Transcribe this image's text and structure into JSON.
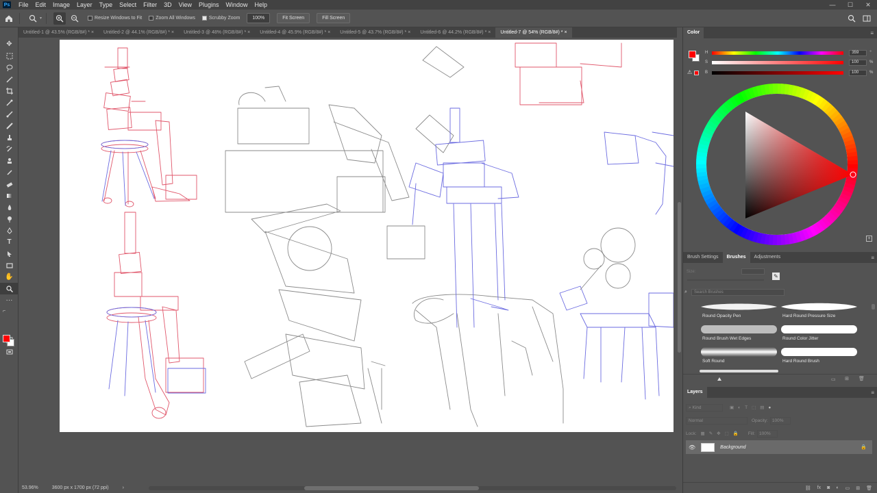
{
  "menubar": {
    "logo": "Ps",
    "items": [
      "File",
      "Edit",
      "Image",
      "Layer",
      "Type",
      "Select",
      "Filter",
      "3D",
      "View",
      "Plugins",
      "Window",
      "Help"
    ],
    "win_controls": [
      "—",
      "☐",
      "✕"
    ]
  },
  "options": {
    "resize_windows": "Resize Windows to Fit",
    "zoom_all_windows": "Zoom All Windows",
    "scrubby_zoom": "Scrubby Zoom",
    "zoom_percent": "100%",
    "fit_screen": "Fit Screen",
    "fill_screen": "Fill Screen"
  },
  "tabs": [
    "Untitled-1 @ 43.5% (RGB/8#) *",
    "Untitled-2 @ 44.1% (RGB/8#) *",
    "Untitled-3 @ 48% (RGB/8#) *",
    "Untitled-4 @ 45.9% (RGB/8#) *",
    "Untitled-5 @ 43.7% (RGB/8#) *",
    "Untitled-6 @ 44.2% (RGB/8#) *",
    "Untitled-7 @ 54% (RGB/8#) *"
  ],
  "tab_close": "×",
  "active_tab_index": 6,
  "status": {
    "zoom": "53.96%",
    "doc_size": "3600 px x 1700 px (72 ppi)",
    "arrow": "›"
  },
  "color_panel": {
    "title": "Color",
    "h_label": "H",
    "h_value": "359",
    "s_label": "S",
    "s_value": "100",
    "b_label": "B",
    "b_value": "100",
    "unit_deg": "°",
    "unit_pct": "%",
    "foreground": "#ff0000",
    "background": "#ffffff"
  },
  "brush_panel": {
    "tabs": [
      "Brush Settings",
      "Brushes",
      "Adjustments"
    ],
    "active_tab": "Brushes",
    "size_label": "Size:",
    "search_placeholder": "Search Brushes",
    "brushes": [
      "Round Opacity Pen",
      "Hard Round Pressure Size",
      "Round Brush Wet Edges",
      "Round Color Jitter",
      "Soft Round",
      "Hard Round Brush"
    ]
  },
  "layers_panel": {
    "title": "Layers",
    "filter_placeholder": "Kind",
    "blend_mode": "Normal",
    "opacity_label": "Opacity:",
    "opacity_value": "100%",
    "lock_label": "Lock:",
    "fill_label": "Fill:",
    "fill_value": "100%",
    "layer_name": "Background"
  },
  "colors": {
    "sketch_red": "#e0566a",
    "sketch_blue": "#6a6ae0",
    "sketch_gray": "#7a7a7a"
  }
}
